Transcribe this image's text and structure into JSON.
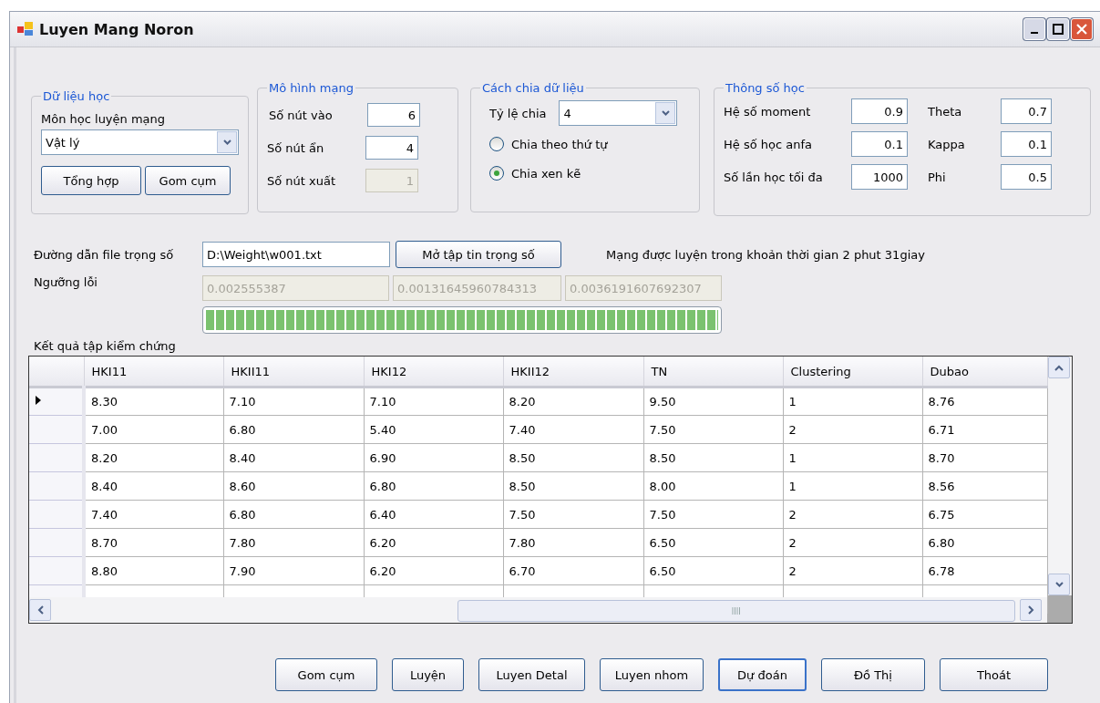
{
  "window": {
    "title": "Luyen Mang Noron"
  },
  "data_group": {
    "title": "Dữ liệu học",
    "label": "Môn học luyện mạng",
    "subject": "Vật lý",
    "buttons": [
      "Tổng hợp",
      "Gom cụm"
    ]
  },
  "model_group": {
    "title": "Mô hình mạng",
    "fields": [
      {
        "label": "Số nút vào",
        "value": "6",
        "disabled": false
      },
      {
        "label": "Số nút ẩn",
        "value": "4",
        "disabled": false
      },
      {
        "label": "Số nút xuất",
        "value": "1",
        "disabled": true
      }
    ]
  },
  "split_group": {
    "title": "Cách chia dữ liệu",
    "ratio_label": "Tỷ lệ chia",
    "ratio": "4",
    "options": [
      {
        "label": "Chia theo thứ tự",
        "selected": false
      },
      {
        "label": "Chia xen kẽ",
        "selected": true
      }
    ]
  },
  "params_group": {
    "title": "Thông số học",
    "fields": [
      {
        "label": "Hệ số moment",
        "value": "0.9"
      },
      {
        "label": "Theta",
        "value": "0.7"
      },
      {
        "label": "Hệ số học anfa",
        "value": "0.1"
      },
      {
        "label": "Kappa",
        "value": "0.1"
      },
      {
        "label": "Số lần học tối đa",
        "value": "1000"
      },
      {
        "label": "Phi",
        "value": "0.5"
      }
    ]
  },
  "weights": {
    "label": "Đường dẫn file trọng số",
    "path": "D:\\Weight\\w001.txt",
    "button": "Mở tập tin trọng số",
    "message": "Mạng được luyện trong khoản thời gian 2 phut 31giay"
  },
  "error": {
    "label": "Ngưỡng lỗi",
    "values": [
      "0.002555387",
      "0.00131645960784313",
      "0.0036191607692307"
    ]
  },
  "progress": {
    "level": 1
  },
  "results": {
    "label": "Kết quả tập kiểm chứng",
    "columns": [
      "HKI11",
      "HKII11",
      "HKI12",
      "HKII12",
      "TN",
      "Clustering",
      "Dubao"
    ],
    "rows": [
      {
        "current": true,
        "cells": [
          "8.30",
          "7.10",
          "7.10",
          "8.20",
          "9.50",
          "1",
          "8.76"
        ]
      },
      {
        "current": false,
        "cells": [
          "7.00",
          "6.80",
          "5.40",
          "7.40",
          "7.50",
          "2",
          "6.71"
        ]
      },
      {
        "current": false,
        "cells": [
          "8.20",
          "8.40",
          "6.90",
          "8.50",
          "8.50",
          "1",
          "8.70"
        ]
      },
      {
        "current": false,
        "cells": [
          "8.40",
          "8.60",
          "6.80",
          "8.50",
          "8.00",
          "1",
          "8.56"
        ]
      },
      {
        "current": false,
        "cells": [
          "7.40",
          "6.80",
          "6.40",
          "7.50",
          "7.50",
          "2",
          "6.75"
        ]
      },
      {
        "current": false,
        "cells": [
          "8.70",
          "7.80",
          "6.20",
          "7.80",
          "6.50",
          "2",
          "6.80"
        ]
      },
      {
        "current": false,
        "cells": [
          "8.80",
          "7.90",
          "6.20",
          "6.70",
          "6.50",
          "2",
          "6.78"
        ]
      }
    ]
  },
  "buttons": [
    {
      "label": "Gom cụm",
      "default": false
    },
    {
      "label": "Luyện",
      "default": false
    },
    {
      "label": "Luyen Detal",
      "default": false
    },
    {
      "label": "Luyen nhom",
      "default": false
    },
    {
      "label": "Dự đoán",
      "default": true
    },
    {
      "label": "Đồ Thị",
      "default": false
    },
    {
      "label": "Thoát",
      "default": false
    }
  ]
}
